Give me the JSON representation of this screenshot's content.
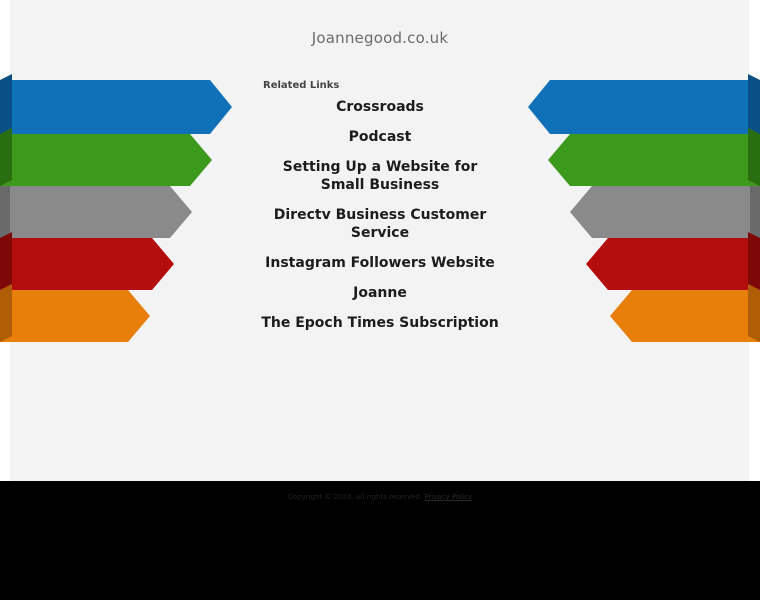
{
  "header": {
    "domain": "Joannegood.co.uk"
  },
  "related": {
    "heading": "Related Links",
    "links": [
      {
        "label": "Crossroads"
      },
      {
        "label": "Podcast"
      },
      {
        "label": "Setting Up a Website for Small Business"
      },
      {
        "label": "Directv Business Customer Service"
      },
      {
        "label": "Instagram Followers Website"
      },
      {
        "label": "Joanne"
      },
      {
        "label": "The Epoch Times Subscription"
      }
    ]
  },
  "footer": {
    "text": "Copyright © 2024. All rights reserved.",
    "link": "Privacy Policy"
  },
  "colors": {
    "page_bg": "#f3f3f3",
    "footer_bg": "#000000",
    "arrow_blue": "#1070b8",
    "arrow_green": "#3d9a1c",
    "arrow_gray": "#8a8a8a",
    "arrow_red": "#b30d0d",
    "arrow_orange": "#e87f0a"
  }
}
